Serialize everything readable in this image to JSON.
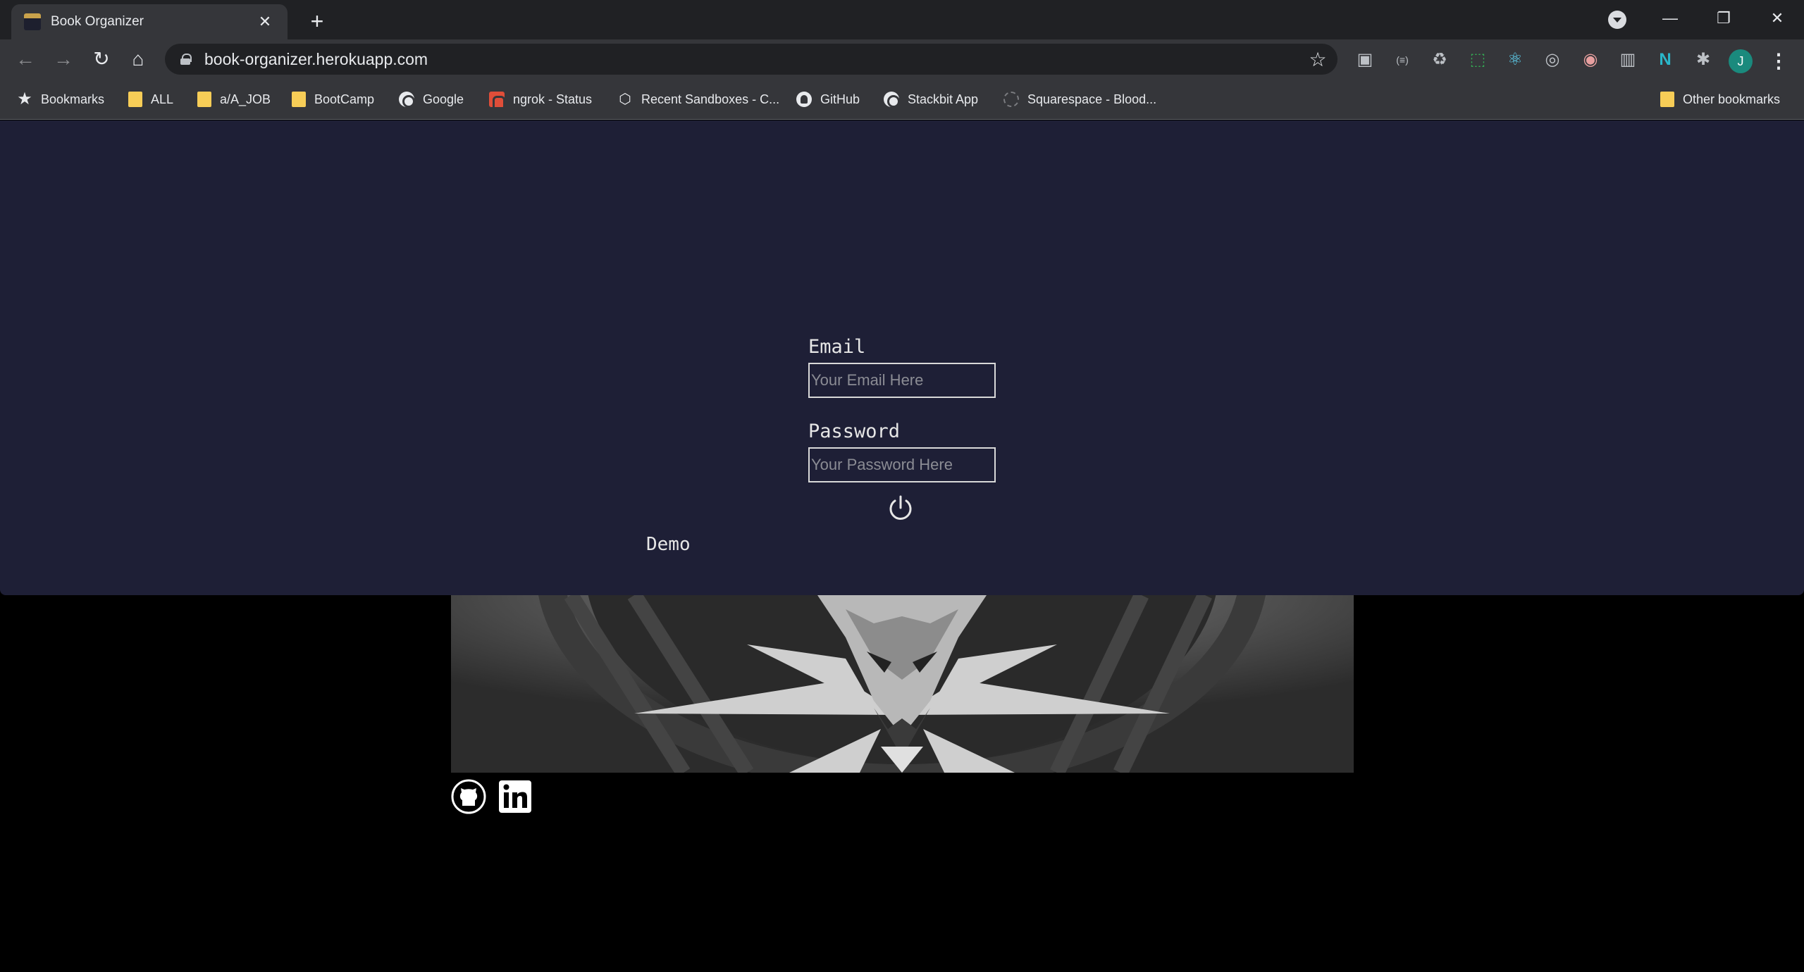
{
  "browser": {
    "tab_title": "Book Organizer",
    "tab_close": "✕",
    "new_tab": "+",
    "url": "book-organizer.herokuapp.com",
    "avatar_initial": "J",
    "window": {
      "minimize": "—",
      "restore": "❐",
      "close": "✕"
    },
    "nav": {
      "back": "←",
      "forward": "→",
      "reload": "↻",
      "home": "⌂"
    },
    "extensions": [
      "screencast-icon",
      "brackets-icon",
      "recycle-icon",
      "screenshot-icon",
      "react-devtools-icon",
      "target-icon",
      "color-picker-icon",
      "barcode-icon",
      "n-icon",
      "puzzle-icon"
    ]
  },
  "bookmarks": [
    {
      "label": "Bookmarks",
      "icon": "star"
    },
    {
      "label": "ALL",
      "icon": "folder"
    },
    {
      "label": "a/A_JOB",
      "icon": "folder"
    },
    {
      "label": "BootCamp",
      "icon": "folder"
    },
    {
      "label": "Google",
      "icon": "globe"
    },
    {
      "label": "ngrok - Status",
      "icon": "ngrok"
    },
    {
      "label": "Recent Sandboxes - C...",
      "icon": "cube"
    },
    {
      "label": "GitHub",
      "icon": "github"
    },
    {
      "label": "Stackbit App",
      "icon": "globe"
    },
    {
      "label": "Squarespace - Blood...",
      "icon": "squarespace"
    }
  ],
  "other_bookmarks": "Other bookmarks",
  "login": {
    "email_label": "Email",
    "email_placeholder": "Your Email Here",
    "password_label": "Password",
    "password_placeholder": "Your Password Here",
    "submit_icon": "power-icon",
    "demo_label": "Demo"
  },
  "footer": {
    "links": [
      "github-icon",
      "linkedin-icon"
    ]
  },
  "colors": {
    "panel_bg": "#1e1f36",
    "page_bg": "#000000",
    "chrome_dark": "#202124",
    "chrome_light": "#35363a"
  }
}
